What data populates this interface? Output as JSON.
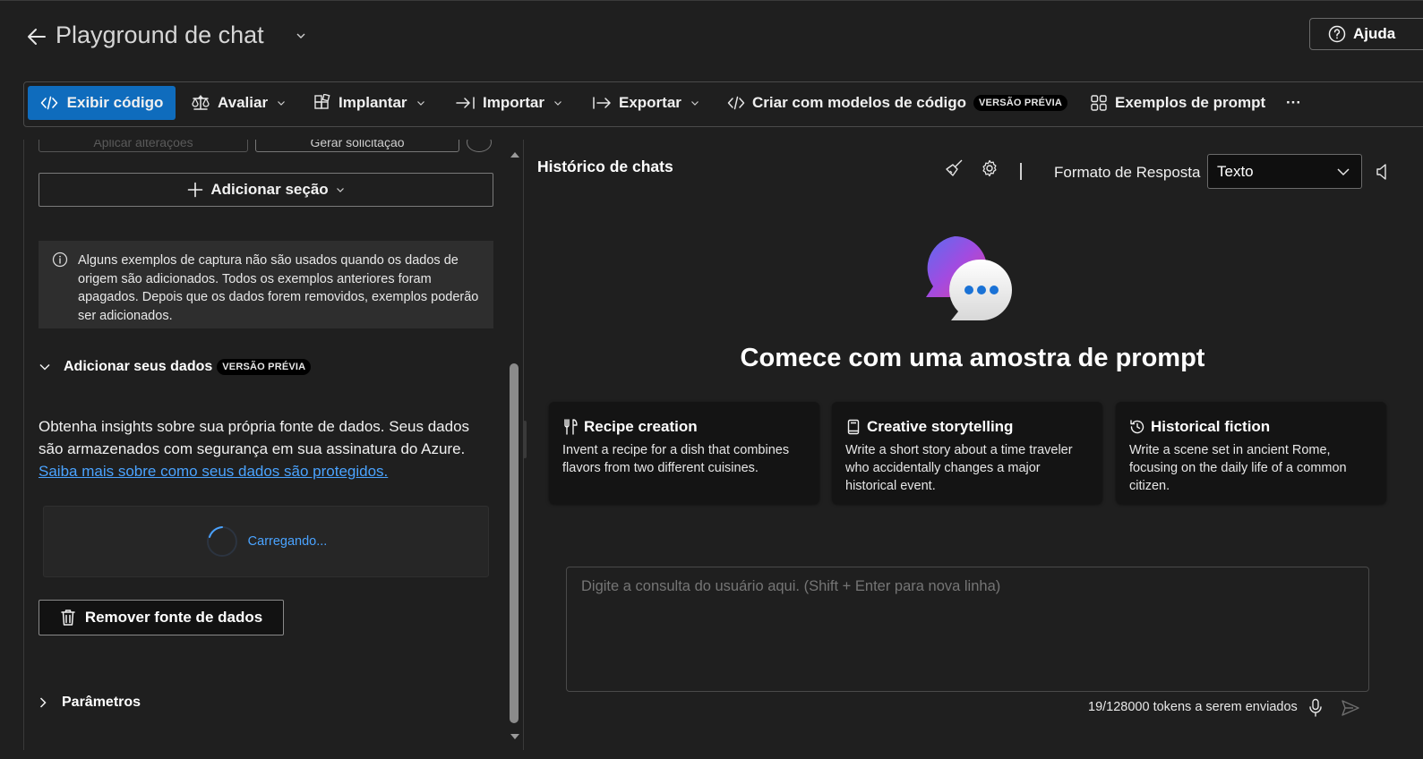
{
  "header": {
    "title": "Playground de chat",
    "help_label": "Ajuda"
  },
  "toolbar": {
    "view_code": "Exibir código",
    "evaluate": "Avaliar",
    "deploy": "Implantar",
    "import": "Importar",
    "export": "Exportar",
    "create_with_code": "Criar com modelos de código",
    "preview_badge": "VERSÃO PRÉVIA",
    "prompt_examples": "Exemplos de prompt",
    "more": "···"
  },
  "left": {
    "apply_changes": "Aplicar alterações",
    "generate_request": "Gerar solicitação",
    "add_section": "Adicionar seção",
    "info_text": "Alguns exemplos de captura não são usados quando os dados de origem são adicionados. Todos os exemplos anteriores foram apagados. Depois que os dados forem removidos, exemplos poderão ser adicionados.",
    "data_heading": "Adicionar seus dados",
    "data_badge": "VERSÃO PRÉVIA",
    "data_desc": "Obtenha insights sobre sua própria fonte de dados. Seus dados são armazenados com segurança em sua assinatura do Azure.",
    "data_link": "Saiba mais sobre como seus dados são protegidos.",
    "loading": "Carregando...",
    "remove_source": "Remover fonte de dados",
    "parameters": "Parâmetros"
  },
  "chat": {
    "history_title": "Histórico de chats",
    "response_format_label": "Formato de Resposta",
    "response_format_value": "Texto",
    "welcome": "Comece com uma amostra de prompt",
    "cards": [
      {
        "title": "Recipe creation",
        "desc": "Invent a recipe for a dish that combines flavors from two different cuisines.",
        "icon": "utensils-icon"
      },
      {
        "title": "Creative storytelling",
        "desc": "Write a short story about a time traveler who accidentally changes a major historical event.",
        "icon": "book-icon"
      },
      {
        "title": "Historical fiction",
        "desc": "Write a scene set in ancient Rome, focusing on the daily life of a common citizen.",
        "icon": "history-icon"
      }
    ],
    "input_placeholder": "Digite a consulta do usuário aqui. (Shift + Enter para nova linha)",
    "tokens": "19/128000 tokens a serem enviados"
  },
  "colors": {
    "background": "#1f1f1f",
    "primary": "#0f6cbd",
    "link": "#4aa3ff"
  }
}
